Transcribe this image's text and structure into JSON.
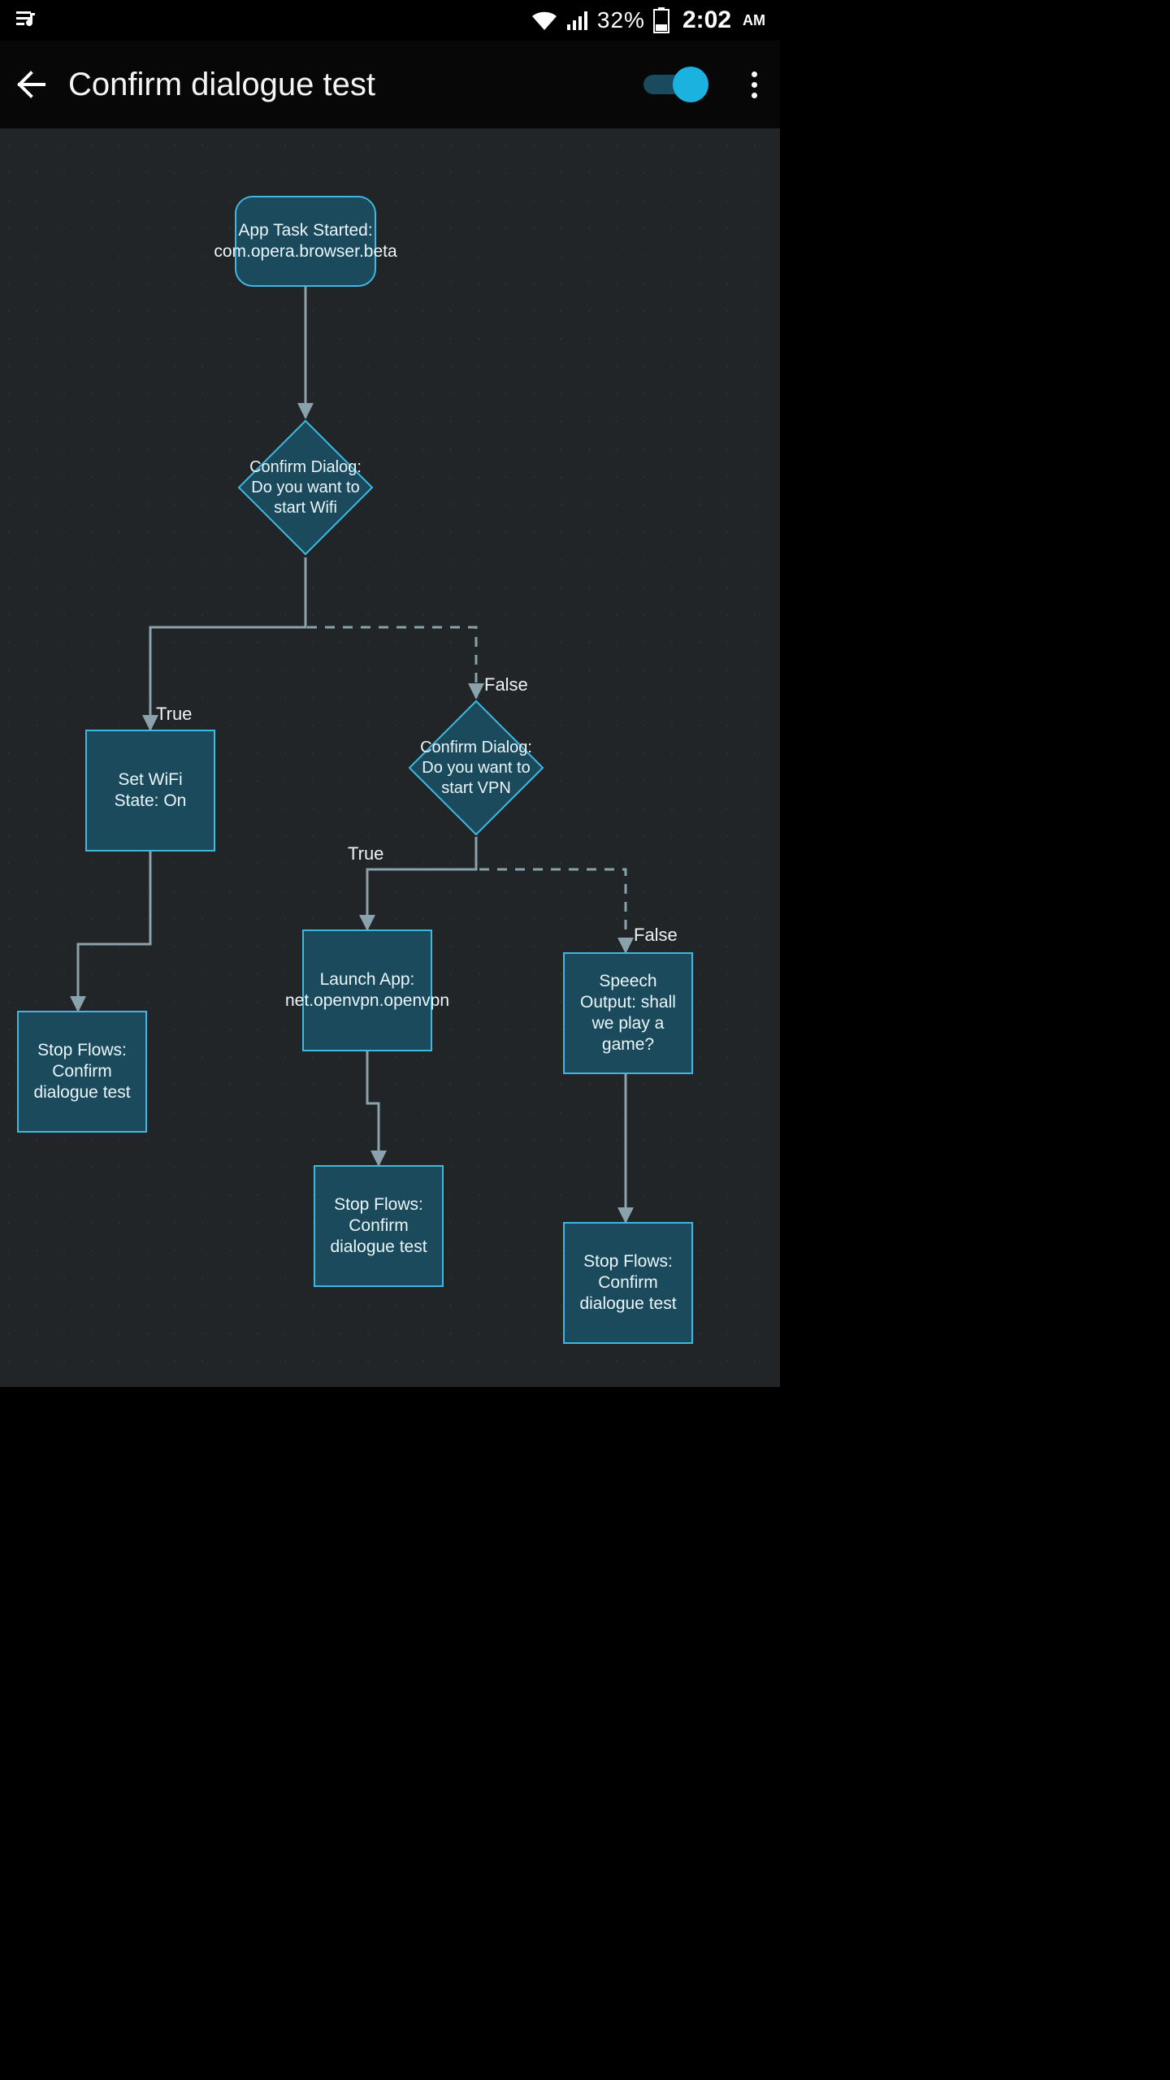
{
  "status_bar": {
    "battery_pct": "32%",
    "time": "2:02",
    "ampm": "AM"
  },
  "app_bar": {
    "title": "Confirm dialogue test",
    "toggle_on": true
  },
  "flow": {
    "start": "App Task Started: com.opera.browser.beta",
    "dialog1": "Confirm Dialog: Do you want to start Wifi",
    "wifi_on": "Set WiFi State: On",
    "stop1": "Stop Flows: Confirm dialogue test",
    "dialog2": "Confirm Dialog: Do you want to start VPN",
    "launch": "Launch App: net.openvpn.openvpn",
    "stop2": "Stop Flows: Confirm dialogue test",
    "speech": "Speech Output: shall we play a game?",
    "stop3": "Stop Flows: Confirm dialogue test"
  },
  "labels": {
    "true": "True",
    "false": "False"
  }
}
